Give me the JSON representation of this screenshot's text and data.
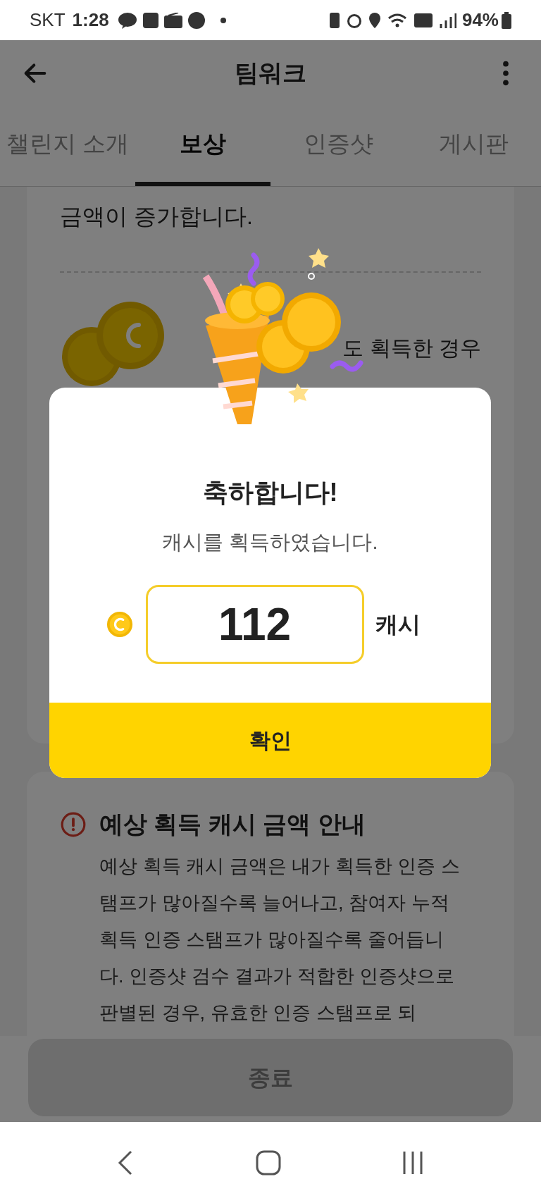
{
  "status_bar": {
    "carrier": "SKT",
    "time": "1:28",
    "battery": "94%"
  },
  "header": {
    "title": "팀워크"
  },
  "tabs": [
    {
      "label": "챌린지 소개",
      "selected": false
    },
    {
      "label": "보상",
      "selected": true
    },
    {
      "label": "인증샷",
      "selected": false
    },
    {
      "label": "게시판",
      "selected": false
    }
  ],
  "reward_card": {
    "text": "금액이 증가합니다.",
    "coin_text": "도 획득한 경우"
  },
  "notice": {
    "title": "예상 획득 캐시 금액 안내",
    "body": "예상 획득 캐시 금액은 내가 획득한 인증 스탬프가 많아질수록 늘어나고, 참여자 누적 획득 인증 스탬프가 많아질수록 줄어듭니다. 인증샷 검수 결과가 적합한 인증샷으로 판별된 경우, 유효한 인증 스탬프로 되"
  },
  "bottom_button": {
    "label": "종료",
    "disabled": true
  },
  "modal": {
    "title": "축하합니다!",
    "message": "캐시를 획득하였습니다.",
    "amount": "112",
    "unit": "캐시",
    "confirm": "확인"
  }
}
